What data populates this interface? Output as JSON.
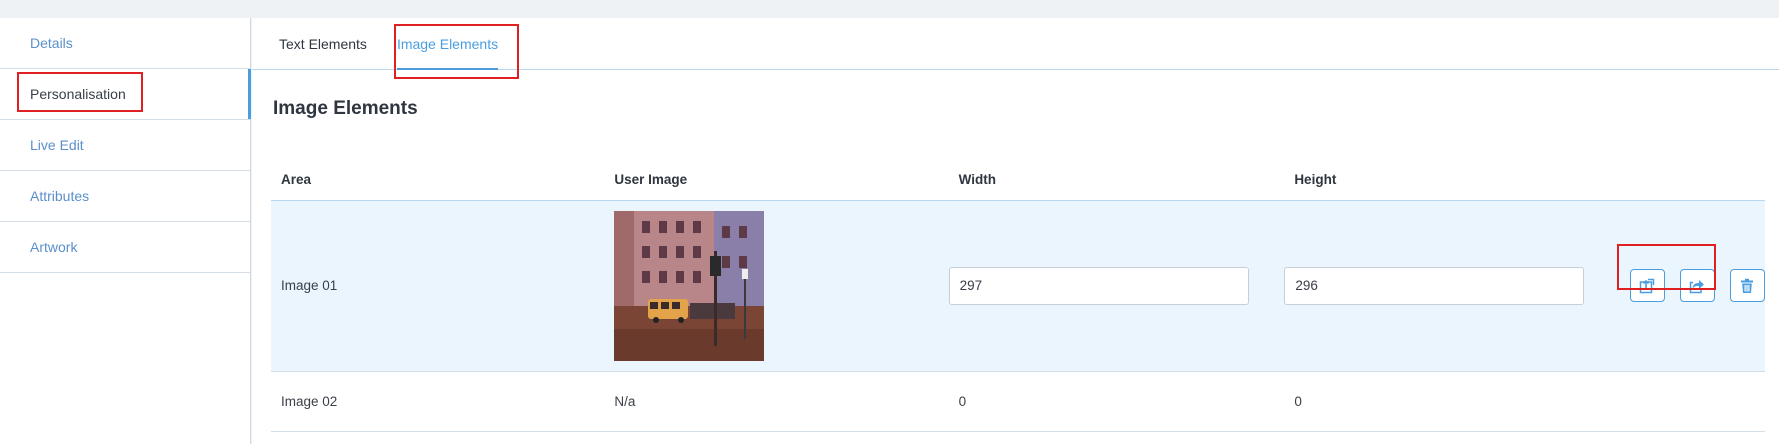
{
  "sidebar": {
    "items": [
      {
        "label": "Details"
      },
      {
        "label": "Personalisation"
      },
      {
        "label": "Live Edit"
      },
      {
        "label": "Attributes"
      },
      {
        "label": "Artwork"
      }
    ]
  },
  "tabs": [
    {
      "label": "Text Elements"
    },
    {
      "label": "Image Elements"
    }
  ],
  "section_title": "Image Elements",
  "table": {
    "headers": {
      "area": "Area",
      "user_image": "User Image",
      "width": "Width",
      "height": "Height"
    },
    "rows": [
      {
        "area": "Image 01",
        "user_image": "street-photo",
        "width": "297",
        "height": "296"
      },
      {
        "area": "Image 02",
        "user_image": "N/a",
        "width": "0",
        "height": "0"
      }
    ]
  },
  "actions": {
    "icons": [
      "upload-icon",
      "share-icon",
      "trash-icon"
    ]
  },
  "colors": {
    "accent": "#4a9ee0",
    "highlight_row": "#eaf5fd",
    "annotation": "#e02020"
  }
}
